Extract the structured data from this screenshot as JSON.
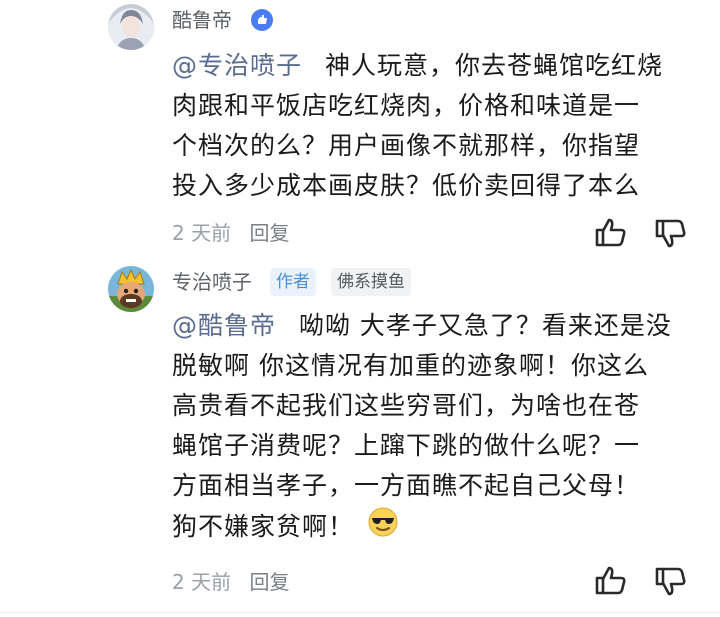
{
  "comments": [
    {
      "author": "酷鲁帝",
      "mention": "@专治喷子",
      "lines": [
        "神人玩意，你去苍蝇馆吃红烧",
        "肉跟和平饭店吃红烧肉，价格和味道是一",
        "个档次的么？用户画像不就那样，你指望",
        "投入多少成本画皮肤？低价卖回得了本么"
      ],
      "time": "2 天前",
      "reply_label": "回复"
    },
    {
      "author": "专治喷子",
      "author_tag": "作者",
      "group_tag": "佛系摸鱼",
      "mention": "@酷鲁帝",
      "lines": [
        "呦呦 大孝子又急了？看来还是没",
        "脱敏啊 你这情况有加重的迹象啊！你这么",
        "高贵看不起我们这些穷哥们，为啥也在苍",
        "蝇馆子消费呢？上蹿下跳的做什么呢？一",
        "方面相当孝子，一方面瞧不起自己父母！",
        "狗不嫌家贫啊！"
      ],
      "emoji": "sunglasses-emoji",
      "time": "2 天前",
      "reply_label": "回复"
    }
  ],
  "colors": {
    "verified_badge": "#4a7ef0",
    "author_tag_bg": "#eaf2fb",
    "author_tag_text": "#4a8fd6",
    "mention": "#5a6c90"
  }
}
